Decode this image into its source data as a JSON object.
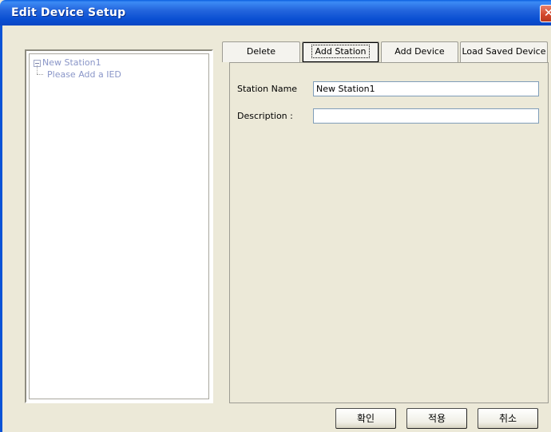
{
  "window": {
    "title": "Edit Device Setup",
    "close_glyph": "✕"
  },
  "tree": {
    "root_label": "New Station1",
    "child_label": "Please Add a IED"
  },
  "tabs": [
    {
      "label": "Delete"
    },
    {
      "label": "Add Station",
      "selected": true
    },
    {
      "label": "Add Device"
    },
    {
      "label": "Load Saved Device"
    }
  ],
  "form": {
    "station_name_label": "Station Name",
    "station_name_value": "New Station1",
    "description_label": "Description :",
    "description_value": ""
  },
  "footer": {
    "ok_label": "확인",
    "apply_label": "적용",
    "cancel_label": "취소"
  },
  "colors": {
    "title_bar": "#0A4FD2",
    "tree_text": "#8A96C8",
    "dialog_bg": "#ECE9D8"
  }
}
